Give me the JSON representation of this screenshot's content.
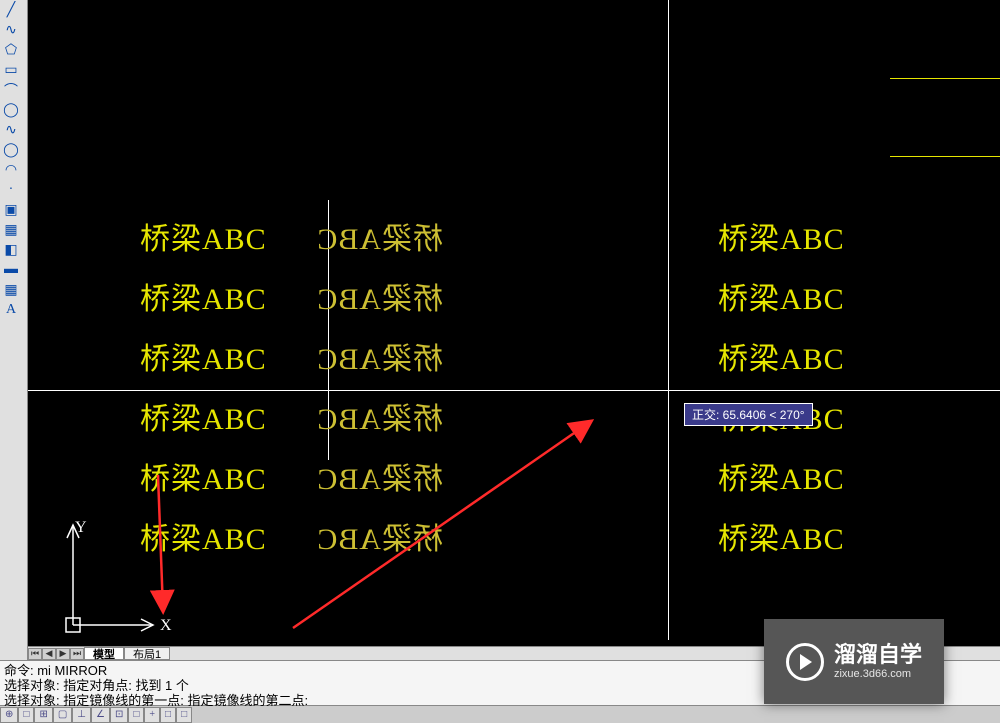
{
  "tools": [
    {
      "name": "line-icon",
      "glyph": "╱"
    },
    {
      "name": "polyline-icon",
      "glyph": "∿"
    },
    {
      "name": "polygon-icon",
      "glyph": "⬠"
    },
    {
      "name": "rectangle-icon",
      "glyph": "▭"
    },
    {
      "name": "arc-icon",
      "glyph": "⌒"
    },
    {
      "name": "circle-icon",
      "glyph": "◯"
    },
    {
      "name": "spline-icon",
      "glyph": "∿"
    },
    {
      "name": "ellipse-icon",
      "glyph": "◯"
    },
    {
      "name": "ellipse-arc-icon",
      "glyph": "◠"
    },
    {
      "name": "point-icon",
      "glyph": "·"
    },
    {
      "name": "block-icon",
      "glyph": "▣"
    },
    {
      "name": "hatch-icon",
      "glyph": "▦"
    },
    {
      "name": "gradient-icon",
      "glyph": "◧"
    },
    {
      "name": "region-icon",
      "glyph": "▬"
    },
    {
      "name": "table-icon",
      "glyph": "▦"
    },
    {
      "name": "text-icon",
      "glyph": "A"
    }
  ],
  "canvas": {
    "text_value": "桥梁ABC",
    "mirrored_glyph": "CBA梁桥",
    "tooltip": "正交: 65.6406 < 270°",
    "ucs": {
      "y_label": "Y",
      "x_label": "X"
    }
  },
  "tabs": {
    "model": "模型",
    "layout1": "布局1"
  },
  "command": {
    "line1": "命令: mi MIRROR",
    "line2": "选择对象: 指定对角点: 找到 1 个",
    "line3": "选择对象:  指定镜像线的第一点: 指定镜像线的第二点:"
  },
  "status_items": [
    "⊕",
    "□",
    "⊞",
    "▢",
    "⊥",
    "∠",
    "⊡",
    "□",
    "+",
    "□",
    "□"
  ],
  "watermark": {
    "big": "溜溜自学",
    "small": "zixue.3d66.com"
  }
}
